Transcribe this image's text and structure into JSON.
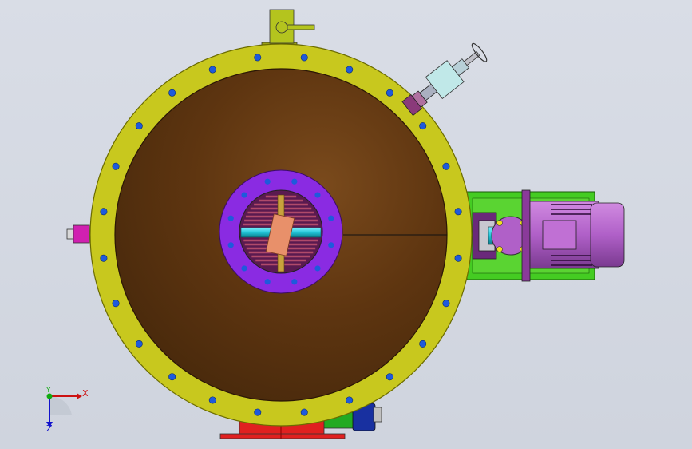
{
  "viewport": {
    "background_top": "#d9dde6",
    "background_bottom": "#cfd4de"
  },
  "colors": {
    "flange": "#c8c81e",
    "flange_edge": "#6b6b00",
    "bolt": "#1e5adc",
    "tank_interior": "#5a3410",
    "tank_highlight": "#7a4a1c",
    "manway_ring": "#8a2be2",
    "grating": "#b04a6a",
    "shaft": "#22c4d8",
    "coupling": "#e8906a",
    "pin": "#c8a23c",
    "motor": "#b060c8",
    "motor_base": "#44cc22",
    "valve_body": "#c0e8e8",
    "valve_flange": "#8a3a7a",
    "inlet_pipe": "#b4c41e",
    "nozzle_left": "#d020b0",
    "bottom_flange": "#e02020",
    "bottom_pipe": "#22aa22",
    "bottom_cap": "#1830a0"
  },
  "triad": {
    "x_label": "X",
    "y_label": "Y",
    "z_label": "Z",
    "x_color": "#cc1111",
    "y_color": "#11aa11",
    "z_color": "#1111cc"
  }
}
